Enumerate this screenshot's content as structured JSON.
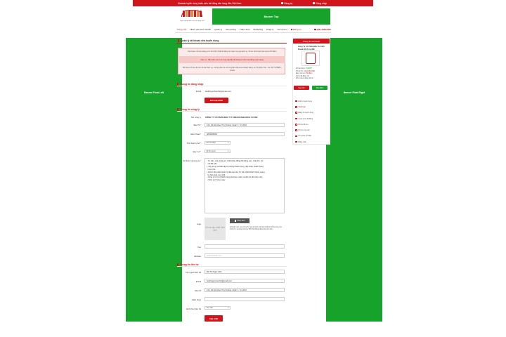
{
  "topbar": {
    "tagline": "Website tuyển dụng nhân viên bất động sản hàng đầu Việt Nam",
    "register": "Đăng ký",
    "login": "Đăng nhập"
  },
  "logo": {
    "caption": "Tuyển dụng nhân viên bất động sản"
  },
  "banner_top": "Banner Top",
  "nav": {
    "items": [
      "Trang chủ",
      "Nhân viên kinh doanh",
      "Quản lý",
      "Văn phòng",
      "Thẩm định",
      "Marketing",
      "Pháp lý",
      "Xem thêm"
    ],
    "register": "Đăng tin",
    "hotline": "(08) 39302056"
  },
  "banner_left": "Banner Float Left",
  "banner_right": "Banner Float Right",
  "page_title": "Quản lý tài khoản nhà tuyển dụng",
  "notice": {
    "line1": "Tài khoản của bạn đang có 3.312.561 VNĐ để đăng tin hoặc mua gói dịch vụ. Số dư tài khoản hiện tại là 150 điểm.",
    "line2": "Cảm ơn. Hãy kiểm tra kĩ và cung cấp đầy đủ thông tin cho hoạt động tuyển dụng.",
    "line3": "Để được hỗ trợ tốt hơn về các dịch vụ, vui lòng liên hệ với bộ phận chăm sóc khách hàng: Lê Thị Minh Thư - 01: 0977375686 - Email"
  },
  "login_section": {
    "title": "Thông tin đăng nhập",
    "email_label": "Email",
    "email_value": "buithingochien91@gmail.com",
    "change_password": "Đổi mật khẩu"
  },
  "company_section": {
    "title": "Thông tin công ty",
    "name_label": "Tên công ty",
    "name_value": "CÔNG TY CỔ PHẦN ĐẦU TƯ KINH DOANH DỊCH VỤ 389",
    "address_label": "Địa chỉ",
    "address_value": "124, Hồ Hải Hòa, P.Cô Giang, Quận 1, Tp.HCM",
    "phone_label": "Điện thoại",
    "phone_value": "0803308650",
    "city_label": "Tỉnh thành phố",
    "city_value": "Hồ Chí Minh",
    "size_label": "Quy mô",
    "size_value": "20-50 người",
    "about_label": "Sơ lược về công ty",
    "about_value": "- Tư vấn, sửa chữa gói, chiết khấu đồng bất động sản, nhà phố, Sư\n  sài đất nền.\n+ Xây dựng và thiết lập hệ thống khách hàng, tiếp nhận khách hàng\n  mua nhà.\n+ Được đội phận Quản lý đào tạo các Tư vấn chiết khách hàng mang\n  lại hiệu quả cao nhất.\n- Công ty hỗ trợ khách hàng thường xuyên và tiến bộ để nhân viên\n  chăm sóc hàng ngày",
    "logo_label": "Logo",
    "logo_placeholder": "Chưa cập nhật hình ảnh",
    "choose_file": "Chọn ảnh",
    "logo_note": "(Khuyến cáo: Quý Công Ty nên tải hình ảnh logo thiết kế chất lượng của Công Ty, và dung lượng 2 Mb khổ thẳng bằng cận vừa vào.)",
    "fax_label": "Fax",
    "website_label": "Website",
    "website_placeholder": "www.website.com"
  },
  "contact_section": {
    "title": "Thông tin liên hệ",
    "name_label": "Tên người liên hệ",
    "name_value": "Bùi Thị Ngọc Hiền",
    "email_label": "Email",
    "email_value": "buithingocmien91@gmail.com",
    "address_label": "Địa chỉ",
    "address_value": "124, Hồ Hải Hòa, P.Cô Giang, Quận 1, Tp.HCM",
    "phone_label": "Điện thoại",
    "method_label": "Hình thức liên hệ",
    "method_value": "Trực tiếp",
    "submit": "Cập nhật"
  },
  "sidebar": {
    "header": "Thông tin tài khoản",
    "company": "Công Ty Cổ Phần Đầu Tư Kinh Doanh Dịch Vụ 389",
    "info": [
      {
        "label": "Số tài khoản: ",
        "value": "1534897"
      },
      {
        "label": "Số dư TK: ",
        "value": "3.312.561 VNĐ"
      },
      {
        "label": "Điểm còn lại: ",
        "value": "150 điểm"
      },
      {
        "label": "Số tin đã đăng: ",
        "value": "33"
      },
      {
        "label": "Số tin được đăng: ",
        "value": "96 tin"
      }
    ],
    "btn_deposit": "Nạp tiền",
    "btn_buy": "Mua điểm",
    "menu": [
      "Đổi tin tuyển dụng",
      "Tài khoản",
      "Đăng tin tuyển dụng",
      "Quản lý tin đã đăng",
      "Hồ sơ đã lưu",
      "Hồ sơ ứng viên",
      "Ứng viên gửi đến",
      "Đăng xuất"
    ],
    "active_index": 1
  },
  "colors": {
    "brand": "#d0161c",
    "banner": "#17a32b"
  }
}
